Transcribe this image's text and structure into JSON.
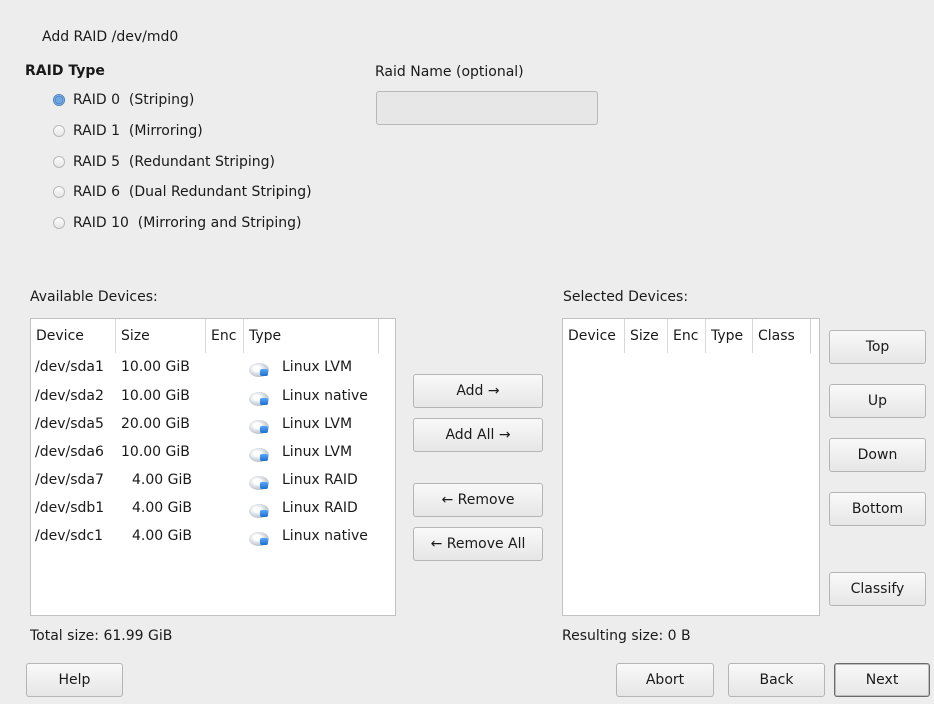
{
  "window_title": "Add RAID /dev/md0",
  "raid_type": {
    "label": "RAID Type",
    "options": [
      {
        "label": "RAID 0  (Striping)",
        "selected": true
      },
      {
        "label": "RAID 1  (Mirroring)",
        "selected": false
      },
      {
        "label": "RAID 5  (Redundant Striping)",
        "selected": false
      },
      {
        "label": "RAID 6  (Dual Redundant Striping)",
        "selected": false
      },
      {
        "label": "RAID 10  (Mirroring and Striping)",
        "selected": false
      }
    ]
  },
  "raid_name": {
    "label": "Raid Name (optional)",
    "value": ""
  },
  "available": {
    "label": "Available Devices:",
    "columns": [
      "Device",
      "Size",
      "Enc",
      "Type"
    ],
    "rows": [
      {
        "device": "/dev/sda1",
        "size": "10.00 GiB",
        "enc": "",
        "type": "Linux LVM"
      },
      {
        "device": "/dev/sda2",
        "size": "10.00 GiB",
        "enc": "",
        "type": "Linux native"
      },
      {
        "device": "/dev/sda5",
        "size": "20.00 GiB",
        "enc": "",
        "type": "Linux LVM"
      },
      {
        "device": "/dev/sda6",
        "size": "10.00 GiB",
        "enc": "",
        "type": "Linux LVM"
      },
      {
        "device": "/dev/sda7",
        "size": "4.00 GiB",
        "enc": "",
        "type": "Linux RAID"
      },
      {
        "device": "/dev/sdb1",
        "size": "4.00 GiB",
        "enc": "",
        "type": "Linux RAID"
      },
      {
        "device": "/dev/sdc1",
        "size": "4.00 GiB",
        "enc": "",
        "type": "Linux native"
      }
    ],
    "total": "Total size: 61.99 GiB"
  },
  "selected": {
    "label": "Selected Devices:",
    "columns": [
      "Device",
      "Size",
      "Enc",
      "Type",
      "Class"
    ],
    "rows": [],
    "total": "Resulting size: 0 B"
  },
  "transfer_buttons": {
    "add": "Add →",
    "add_all": "Add All →",
    "remove": "← Remove",
    "remove_all": "← Remove All"
  },
  "order_buttons": {
    "top": "Top",
    "up": "Up",
    "down": "Down",
    "bottom": "Bottom",
    "classify": "Classify"
  },
  "footer": {
    "help": "Help",
    "abort": "Abort",
    "back": "Back",
    "next": "Next"
  },
  "icons": {
    "device_type": "disk-icon"
  }
}
